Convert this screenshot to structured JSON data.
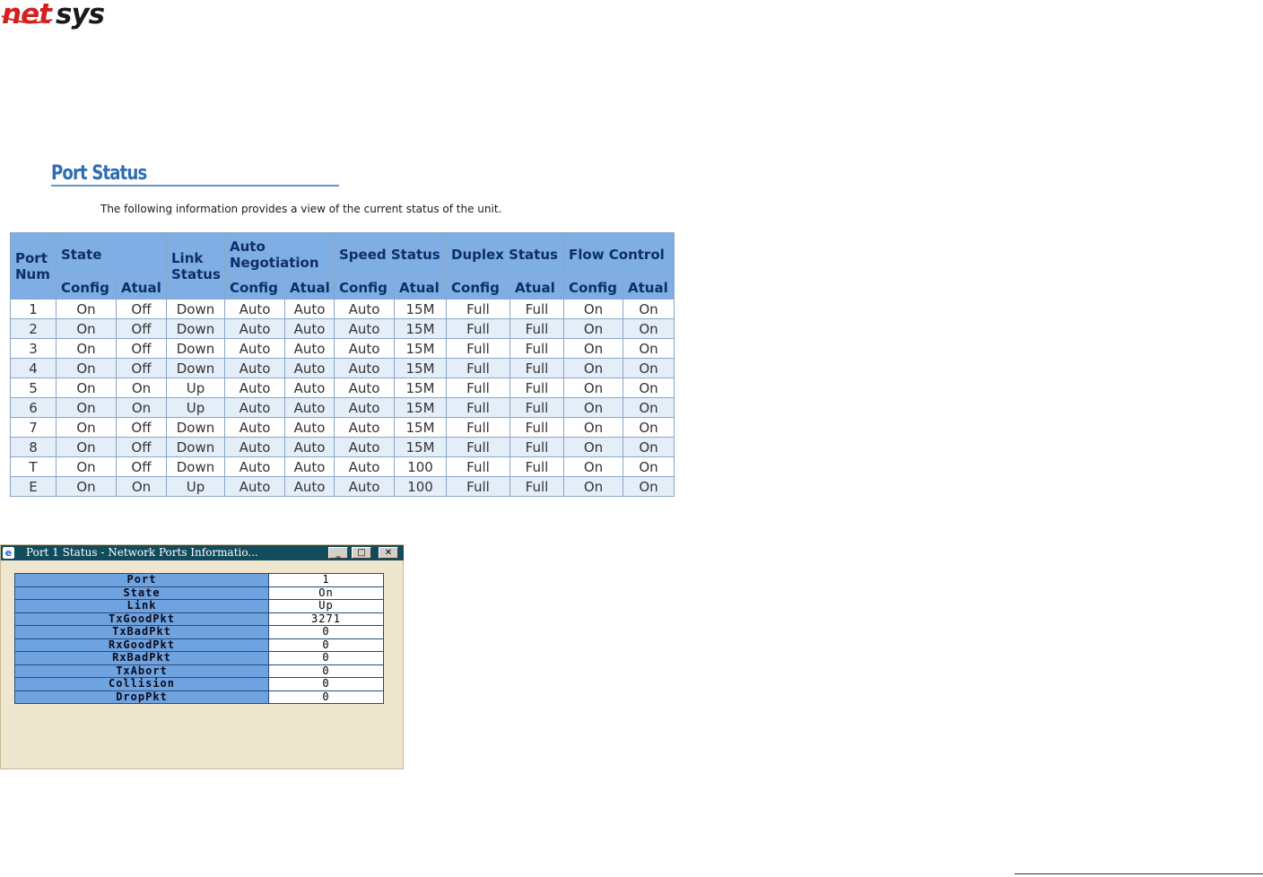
{
  "logo": {
    "text_net": "net",
    "text_sys": "sys"
  },
  "page": {
    "title": "Port Status",
    "description": "The following information provides a view of the current status of the unit."
  },
  "port_table": {
    "headers": {
      "port_num": "Port Num",
      "state": "State",
      "link_status": "Link Status",
      "auto_negotiation": "Auto Negotiation",
      "speed_status": "Speed Status",
      "duplex_status": "Duplex Status",
      "flow_control": "Flow Control",
      "config": "Config",
      "actual": "Atual"
    },
    "rows": [
      [
        "1",
        "On",
        "Off",
        "Down",
        "Auto",
        "Auto",
        "Auto",
        "15M",
        "Full",
        "Full",
        "On",
        "On"
      ],
      [
        "2",
        "On",
        "Off",
        "Down",
        "Auto",
        "Auto",
        "Auto",
        "15M",
        "Full",
        "Full",
        "On",
        "On"
      ],
      [
        "3",
        "On",
        "Off",
        "Down",
        "Auto",
        "Auto",
        "Auto",
        "15M",
        "Full",
        "Full",
        "On",
        "On"
      ],
      [
        "4",
        "On",
        "Off",
        "Down",
        "Auto",
        "Auto",
        "Auto",
        "15M",
        "Full",
        "Full",
        "On",
        "On"
      ],
      [
        "5",
        "On",
        "On",
        "Up",
        "Auto",
        "Auto",
        "Auto",
        "15M",
        "Full",
        "Full",
        "On",
        "On"
      ],
      [
        "6",
        "On",
        "On",
        "Up",
        "Auto",
        "Auto",
        "Auto",
        "15M",
        "Full",
        "Full",
        "On",
        "On"
      ],
      [
        "7",
        "On",
        "Off",
        "Down",
        "Auto",
        "Auto",
        "Auto",
        "15M",
        "Full",
        "Full",
        "On",
        "On"
      ],
      [
        "8",
        "On",
        "Off",
        "Down",
        "Auto",
        "Auto",
        "Auto",
        "15M",
        "Full",
        "Full",
        "On",
        "On"
      ],
      [
        "T",
        "On",
        "Off",
        "Down",
        "Auto",
        "Auto",
        "Auto",
        "100",
        "Full",
        "Full",
        "On",
        "On"
      ],
      [
        "E",
        "On",
        "On",
        "Up",
        "Auto",
        "Auto",
        "Auto",
        "100",
        "Full",
        "Full",
        "On",
        "On"
      ]
    ]
  },
  "popup": {
    "title": "Port 1 Status - Network Ports Informatio...",
    "buttons": {
      "minimize": "_",
      "maximize": "□",
      "close": "✕"
    },
    "stats": [
      {
        "label": "Port",
        "value": "1"
      },
      {
        "label": "State",
        "value": "On"
      },
      {
        "label": "Link",
        "value": "Up"
      },
      {
        "label": "TxGoodPkt",
        "value": "3271"
      },
      {
        "label": "TxBadPkt",
        "value": "0"
      },
      {
        "label": "RxGoodPkt",
        "value": "0"
      },
      {
        "label": "RxBadPkt",
        "value": "0"
      },
      {
        "label": "TxAbort",
        "value": "0"
      },
      {
        "label": "Collision",
        "value": "0"
      },
      {
        "label": "DropPkt",
        "value": "0"
      }
    ]
  },
  "colors": {
    "header_bg": "#7eaee4",
    "title_blue": "#2e6db3",
    "logo_red": "#d4201f",
    "popup_titlebar": "#124b5c",
    "popup_bg": "#efe6cf"
  }
}
